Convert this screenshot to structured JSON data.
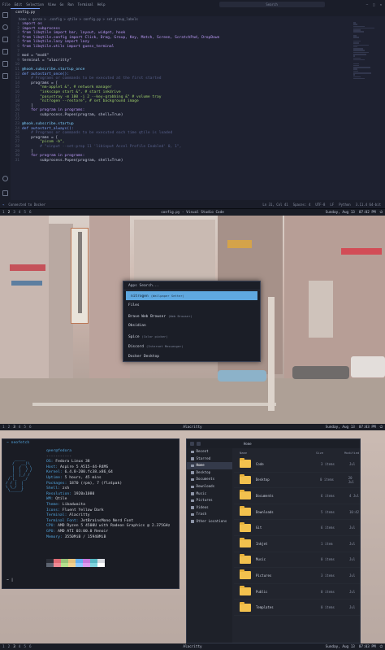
{
  "vscode": {
    "menu": [
      "File",
      "Edit",
      "Selection",
      "View",
      "Go",
      "Run",
      "Terminal",
      "Help"
    ],
    "search_placeholder": "Search",
    "tab_label": "config.py",
    "breadcrumb": "home > qeren > .config > qtile > config.py > set_group_labels",
    "code_lines": [
      {
        "n": "1",
        "t": "import os",
        "c": "kw"
      },
      {
        "n": "2",
        "t": "import subprocess",
        "c": "kw"
      },
      {
        "n": "3",
        "t": "from libqtile import bar, layout, widget, hook",
        "c": "kw"
      },
      {
        "n": "4",
        "t": "from libqtile.config import Click, Drag, Group, Key, Match, Screen, ScratchPad, DropDown",
        "c": "kw"
      },
      {
        "n": "5",
        "t": "from libqtile.lazy import lazy",
        "c": "kw"
      },
      {
        "n": "6",
        "t": "from libqtile.utils import guess_terminal",
        "c": "kw"
      },
      {
        "n": "7",
        "t": "",
        "c": ""
      },
      {
        "n": "8",
        "t": "mod = \"mod4\"",
        "c": ""
      },
      {
        "n": "9",
        "t": "terminal = \"alacritty\"",
        "c": ""
      },
      {
        "n": "10",
        "t": "",
        "c": ""
      },
      {
        "n": "11",
        "t": "@hook.subscribe.startup_once",
        "c": "dc"
      },
      {
        "n": "12",
        "t": "def autostart_once():",
        "c": "fn"
      },
      {
        "n": "13",
        "t": "    # Programs or commands to be executed at the first started",
        "c": "cm"
      },
      {
        "n": "14",
        "t": "    programs = [",
        "c": ""
      },
      {
        "n": "15",
        "t": "        \"nm-applet &\", # network manager",
        "c": "st"
      },
      {
        "n": "16",
        "t": "        \"inkscape start &\", # start inkdrive",
        "c": "st"
      },
      {
        "n": "17",
        "t": "        \"pasystray -m 100 -i 2 --key-grabbing &\" # volume tray",
        "c": "st"
      },
      {
        "n": "18",
        "t": "        \"nitrogen --restore\", # set background image",
        "c": "st"
      },
      {
        "n": "19",
        "t": "    ]",
        "c": ""
      },
      {
        "n": "20",
        "t": "    for program in programs:",
        "c": "kw"
      },
      {
        "n": "21",
        "t": "        subprocess.Popen(program, shell=True)",
        "c": ""
      },
      {
        "n": "22",
        "t": "",
        "c": ""
      },
      {
        "n": "23",
        "t": "@hook.subscribe.startup",
        "c": "dc"
      },
      {
        "n": "24",
        "t": "def autostart_always():",
        "c": "fn"
      },
      {
        "n": "25",
        "t": "    # Programs or commands to be executed each time qtile is loaded",
        "c": "cm"
      },
      {
        "n": "26",
        "t": "    programs = [",
        "c": ""
      },
      {
        "n": "27",
        "t": "        \"picom -b\",",
        "c": "st"
      },
      {
        "n": "28",
        "t": "        # \"xinput --set-prop 11 'libinput Accel Profile Enabled' 0, 1\",",
        "c": "cm"
      },
      {
        "n": "29",
        "t": "    ]",
        "c": ""
      },
      {
        "n": "30",
        "t": "    for program in programs:",
        "c": "kw"
      },
      {
        "n": "31",
        "t": "        subprocess.Popen(program, shell=True)",
        "c": ""
      }
    ],
    "status_left": "Connected to Docker",
    "status_right": [
      "Ln 31, Col 41",
      "Spaces: 4",
      "UTF-8",
      "LF",
      "Python",
      "3.11.4 64-bit"
    ]
  },
  "desktop": {
    "workspaces": [
      "1",
      "2",
      "3",
      "4",
      "5",
      "6"
    ],
    "active_workspace": "2",
    "window_title": "config.py - Visual Studio Code",
    "clock": "Sunday, Aug 13",
    "time": "07:02 PM",
    "launcher": {
      "placeholder": "Apps   Search...",
      "items": [
        {
          "name": "nitrogen",
          "desc": "(Wallpaper Setter)",
          "selected": true
        },
        {
          "name": "Files",
          "desc": ""
        },
        {
          "name": "Brave Web Browser",
          "desc": "(Web Browser)"
        },
        {
          "name": "Obsidian",
          "desc": ""
        },
        {
          "name": "Spice",
          "desc": "(Color picker)"
        },
        {
          "name": "Discord",
          "desc": "(Internet Messenger)"
        },
        {
          "name": "Docker Desktop",
          "desc": ""
        }
      ]
    }
  },
  "workspace3": {
    "window_title": "Alacritty",
    "bottom_title": "Alacritty",
    "clock": "Sunday, Aug 13",
    "time": "07:03 PM",
    "terminal": {
      "command": "~ neofetch",
      "user": "qeer@fedora",
      "separator": "-----------",
      "ascii": [
        "    _____",
        "   /   __)\\",
        "   |  /  \\ \\",
        "   |  |  / /",
        "  _|  |_/ /",
        " / (_   _/",
        "/ / |  |",
        "\\ \\_/  |",
        " \\_____/"
      ],
      "info": [
        {
          "k": "OS:",
          "v": " Fedora Linux 38"
        },
        {
          "k": "Host:",
          "v": " Aspire 5 A515-44-R4MS"
        },
        {
          "k": "Kernel:",
          "v": " 6.4.8-200.fc38.x86_64"
        },
        {
          "k": "Uptime:",
          "v": " 5 hours, 45 mins"
        },
        {
          "k": "Packages:",
          "v": " 1870 (rpm), 7 (flatpak)"
        },
        {
          "k": "Shell:",
          "v": " zsh"
        },
        {
          "k": "Resolution:",
          "v": " 1920x1080"
        },
        {
          "k": "WM:",
          "v": " Qtile"
        },
        {
          "k": "Theme:",
          "v": " Libadwaita"
        },
        {
          "k": "Icons:",
          "v": " Fluent Yellow Dark"
        },
        {
          "k": "Terminal:",
          "v": " Alacritty"
        },
        {
          "k": "Terminal Font:",
          "v": " JetBrainsMono Nerd Font"
        },
        {
          "k": "CPU:",
          "v": " AMD Ryzen 5 4500U with Radeon Graphics @ 2.375GHz"
        },
        {
          "k": "GPU:",
          "v": " AMD ATI 03:00.0 Renoir"
        },
        {
          "k": "Memory:",
          "v": " 3550MiB / 15940MiB"
        }
      ],
      "swatches": [
        "#2a2d36",
        "#e06c75",
        "#98c379",
        "#e5c07b",
        "#61afef",
        "#c678dd",
        "#56b6c2",
        "#d7dae0",
        "#5c6370",
        "#f08a94",
        "#b5e08e",
        "#f2d08f",
        "#8cc8ff",
        "#dd9af0",
        "#7fd3dd",
        "#ffffff"
      ],
      "prompt": "~ |"
    },
    "files": {
      "path": "Home",
      "sidebar": [
        "Recent",
        "Starred",
        "Home",
        "Desktop",
        "Documents",
        "Downloads",
        "Music",
        "Pictures",
        "Videos",
        "Trash",
        "Other Locations"
      ],
      "active_sidebar": "Home",
      "columns": [
        "Name",
        "Size",
        "Modified"
      ],
      "rows": [
        {
          "name": "Code",
          "size": "3 items",
          "date": "Jul"
        },
        {
          "name": "Desktop",
          "size": "0 items",
          "date": "20 Jul"
        },
        {
          "name": "Documents",
          "size": "6 items",
          "date": "4 Jul"
        },
        {
          "name": "Downloads",
          "size": "5 items",
          "date": "10:42"
        },
        {
          "name": "Git",
          "size": "6 items",
          "date": "Jul"
        },
        {
          "name": "Inkjet",
          "size": "1 item",
          "date": "Jul"
        },
        {
          "name": "Music",
          "size": "0 items",
          "date": "Jul"
        },
        {
          "name": "Pictures",
          "size": "3 items",
          "date": "Jul"
        },
        {
          "name": "Public",
          "size": "0 items",
          "date": "Jul"
        },
        {
          "name": "Templates",
          "size": "0 items",
          "date": "Jul"
        }
      ]
    }
  }
}
